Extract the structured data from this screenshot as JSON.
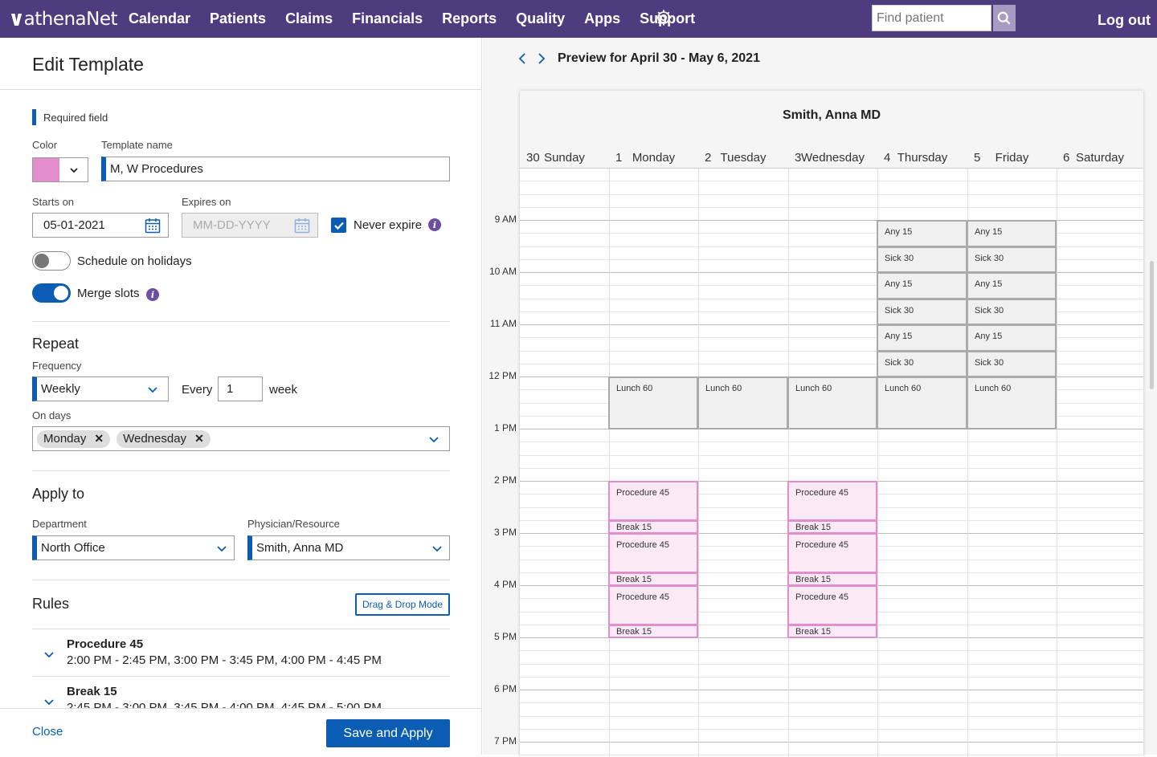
{
  "nav": {
    "logo": "athenaNet",
    "items": [
      "Calendar",
      "Patients",
      "Claims",
      "Financials",
      "Reports",
      "Quality",
      "Apps",
      "Support"
    ],
    "search_placeholder": "Find patient",
    "logout": "Log out"
  },
  "form": {
    "title": "Edit Template",
    "required_field": "Required field",
    "color_label": "Color",
    "color_value": "#e38ecc",
    "template_name_label": "Template name",
    "template_name": "M, W Procedures",
    "starts_on_label": "Starts on",
    "starts_on": "05-01-2021",
    "expires_on_label": "Expires on",
    "expires_on_placeholder": "MM-DD-YYYY",
    "never_expire": "Never expire",
    "never_expire_checked": true,
    "schedule_holidays": "Schedule on holidays",
    "schedule_holidays_on": false,
    "merge_slots": "Merge slots",
    "merge_slots_on": true,
    "repeat_title": "Repeat",
    "frequency_label": "Frequency",
    "frequency": "Weekly",
    "every_label": "Every",
    "every_value": "1",
    "week_label": "week",
    "on_days_label": "On days",
    "on_days": [
      "Monday",
      "Wednesday"
    ],
    "apply_title": "Apply to",
    "department_label": "Department",
    "department": "North Office",
    "physician_label": "Physician/Resource",
    "physician": "Smith, Anna MD",
    "rules_title": "Rules",
    "dnd_button": "Drag & Drop Mode",
    "rules": [
      {
        "title": "Procedure 45",
        "times": "2:00 PM - 2:45 PM, 3:00 PM - 3:45 PM, 4:00 PM - 4:45 PM"
      },
      {
        "title": "Break 15",
        "times": "2:45 PM - 3:00 PM, 3:45 PM - 4:00 PM, 4:45 PM - 5:00 PM"
      }
    ],
    "close": "Close",
    "save": "Save and Apply"
  },
  "preview": {
    "title": "Preview for April 30 -  May 6, 2021",
    "provider": "Smith, Anna MD",
    "days": [
      {
        "num": "30",
        "name": "Sunday"
      },
      {
        "num": "1",
        "name": "Monday"
      },
      {
        "num": "2",
        "name": "Tuesday"
      },
      {
        "num": "3",
        "name": "Wednesday"
      },
      {
        "num": "4",
        "name": "Thursday"
      },
      {
        "num": "5",
        "name": "Friday"
      },
      {
        "num": "6",
        "name": "Saturday"
      }
    ],
    "hours": [
      "9 AM",
      "10 AM",
      "11 AM",
      "12 PM",
      "1 PM",
      "2 PM",
      "3 PM",
      "4 PM",
      "5 PM",
      "6 PM",
      "7 PM"
    ],
    "colors": {
      "template": "#e38ecc",
      "existing": "#aaaaaa",
      "accent": "#0b5db3",
      "nav": "#4f3c7e"
    }
  }
}
